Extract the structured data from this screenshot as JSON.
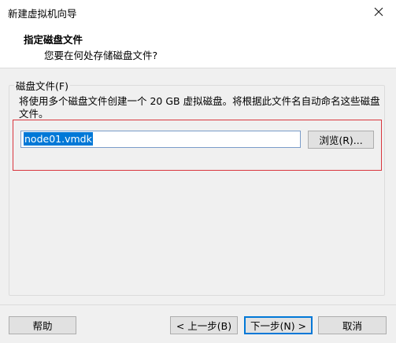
{
  "window": {
    "title": "新建虚拟机向导"
  },
  "header": {
    "title": "指定磁盘文件",
    "subtitle": "您要在何处存储磁盘文件?"
  },
  "disk_file": {
    "group_label": "磁盘文件(F)",
    "description": "将使用多个磁盘文件创建一个 20 GB 虚拟磁盘。将根据此文件名自动命名这些磁盘文件。",
    "filename": "node01.vmdk",
    "browse_label": "浏览(R)..."
  },
  "footer": {
    "help_label": "帮助",
    "back_label": "< 上一步(B)",
    "next_label": "下一步(N) >",
    "cancel_label": "取消"
  },
  "colors": {
    "highlight_border": "#d9363e",
    "selection": "#0078d7"
  }
}
